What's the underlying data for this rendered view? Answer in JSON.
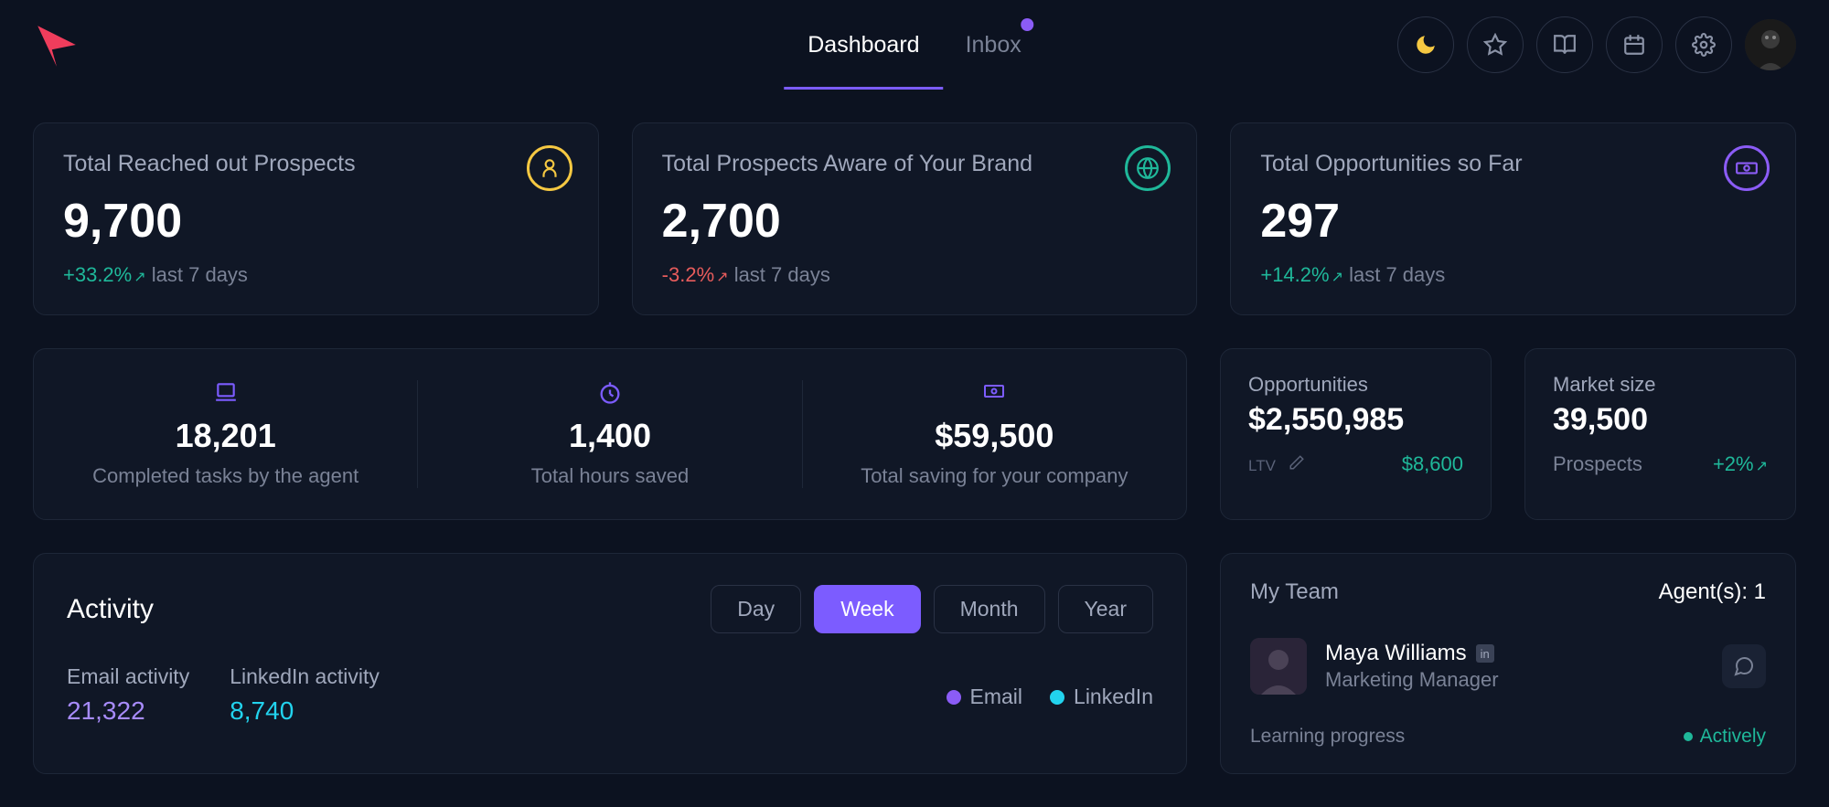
{
  "nav": {
    "tabs": [
      {
        "label": "Dashboard",
        "active": true
      },
      {
        "label": "Inbox",
        "active": false,
        "badge": true
      }
    ]
  },
  "topCards": [
    {
      "title": "Total Reached out Prospects",
      "value": "9,700",
      "trend": "+33.2%",
      "dir": "up",
      "period": "last 7 days",
      "icon": "user",
      "color": "yellow"
    },
    {
      "title": "Total Prospects Aware of Your Brand",
      "value": "2,700",
      "trend": "-3.2%",
      "dir": "down",
      "period": "last 7 days",
      "icon": "globe",
      "color": "teal"
    },
    {
      "title": "Total Opportunities so Far",
      "value": "297",
      "trend": "+14.2%",
      "dir": "up",
      "period": "last 7 days",
      "icon": "money",
      "color": "purple"
    }
  ],
  "stats": [
    {
      "icon": "laptop",
      "value": "18,201",
      "label": "Completed tasks by the agent"
    },
    {
      "icon": "clock",
      "value": "1,400",
      "label": "Total hours saved"
    },
    {
      "icon": "cash",
      "value": "$59,500",
      "label": "Total saving for your company"
    }
  ],
  "oppCard": {
    "title": "Opportunities",
    "value": "$2,550,985",
    "footLabel": "LTV",
    "footValue": "$8,600"
  },
  "marketCard": {
    "title": "Market size",
    "value": "39,500",
    "footLabel": "Prospects",
    "footValue": "+2%"
  },
  "activity": {
    "title": "Activity",
    "ranges": [
      "Day",
      "Week",
      "Month",
      "Year"
    ],
    "activeRange": "Week",
    "cols": [
      {
        "label": "Email activity",
        "value": "21,322",
        "color": "purple"
      },
      {
        "label": "LinkedIn activity",
        "value": "8,740",
        "color": "teal"
      }
    ],
    "legend": [
      {
        "label": "Email",
        "color": "purple"
      },
      {
        "label": "LinkedIn",
        "color": "teal"
      }
    ]
  },
  "team": {
    "title": "My Team",
    "countLabel": "Agent(s): 1",
    "member": {
      "name": "Maya Williams",
      "role": "Marketing Manager"
    },
    "progressLabel": "Learning progress",
    "status": "Actively"
  }
}
